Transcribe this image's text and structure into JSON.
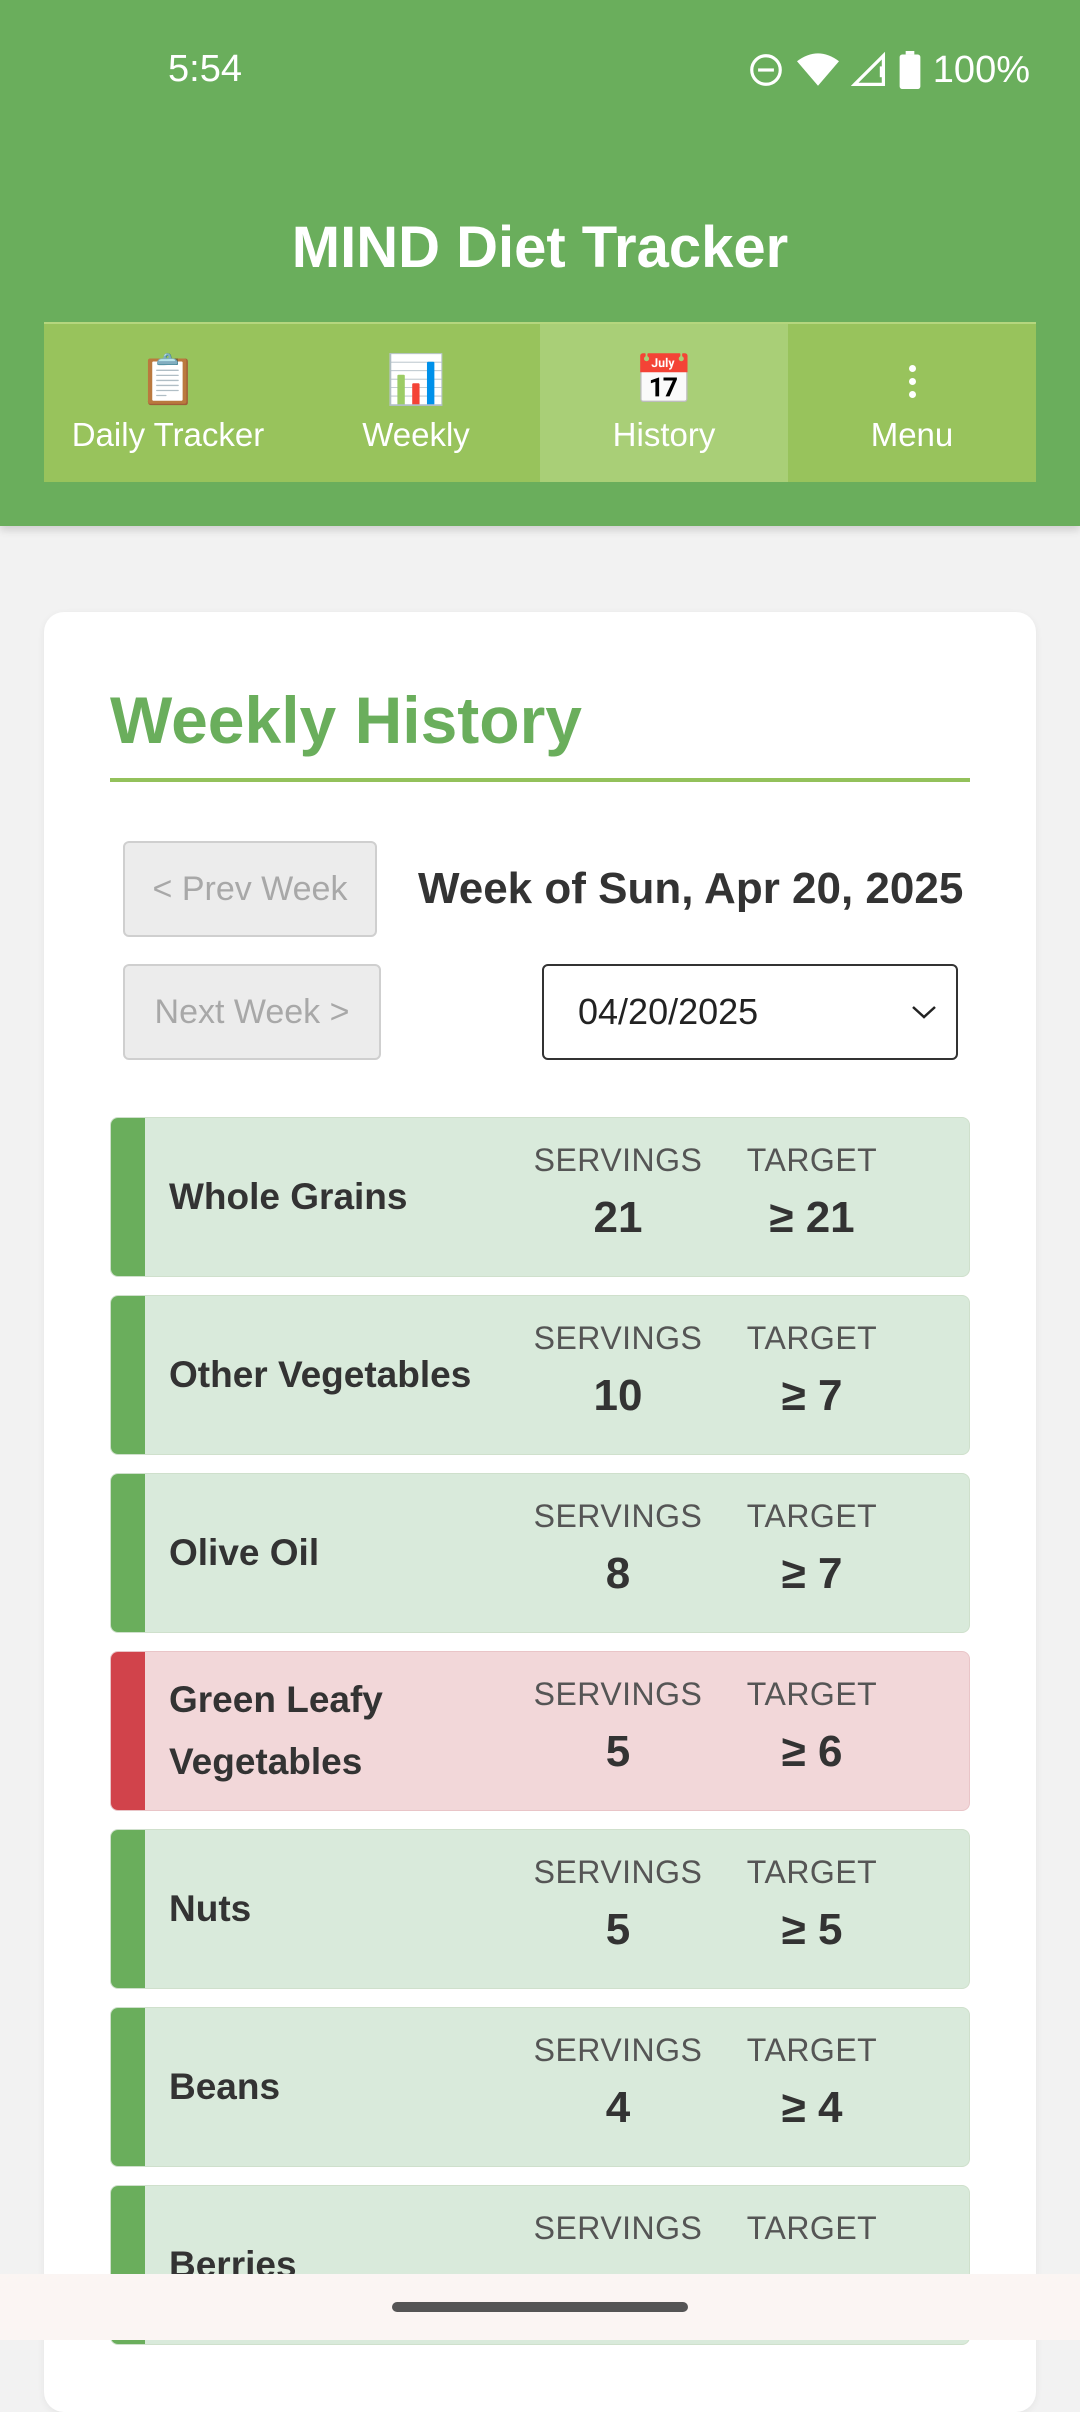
{
  "status_bar": {
    "time": "5:54",
    "battery": "100%",
    "icons": [
      "do-not-disturb-icon",
      "wifi-icon",
      "signal-icon",
      "battery-icon"
    ]
  },
  "app": {
    "title": "MIND Diet Tracker"
  },
  "tabs": [
    {
      "label": "Daily Tracker",
      "icon": "📋",
      "icon_name": "clipboard-icon"
    },
    {
      "label": "Weekly",
      "icon": "📊",
      "icon_name": "bar-chart-icon"
    },
    {
      "label": "History",
      "icon": "📅",
      "icon_name": "calendar-icon",
      "active": true
    },
    {
      "label": "Menu",
      "icon_name": "more-vertical-icon"
    }
  ],
  "history": {
    "title": "Weekly History",
    "prev_label": "< Prev Week",
    "next_label": "Next Week >",
    "week_label": "Week of Sun, Apr 20, 2025",
    "date_value": "04/20/2025"
  },
  "stat_labels": {
    "servings": "SERVINGS",
    "target": "TARGET"
  },
  "items": [
    {
      "name": "Whole Grains",
      "servings": "21",
      "target": "≥ 21",
      "status": "met"
    },
    {
      "name": "Other Vegetables",
      "servings": "10",
      "target": "≥ 7",
      "status": "met"
    },
    {
      "name": "Olive Oil",
      "servings": "8",
      "target": "≥ 7",
      "status": "met"
    },
    {
      "name": "Green Leafy Vegetables",
      "servings": "5",
      "target": "≥ 6",
      "status": "not-met"
    },
    {
      "name": "Nuts",
      "servings": "5",
      "target": "≥ 5",
      "status": "met"
    },
    {
      "name": "Beans",
      "servings": "4",
      "target": "≥ 4",
      "status": "met"
    },
    {
      "name": "Berries",
      "servings": "",
      "target": "",
      "status": "met"
    }
  ],
  "colors": {
    "brand_green": "#6aae5c",
    "tab_bar": "#98c35c",
    "met_bg": "#d9eadb",
    "not_met_bg": "#f2d7d9",
    "not_met_accent": "#d1434b"
  }
}
